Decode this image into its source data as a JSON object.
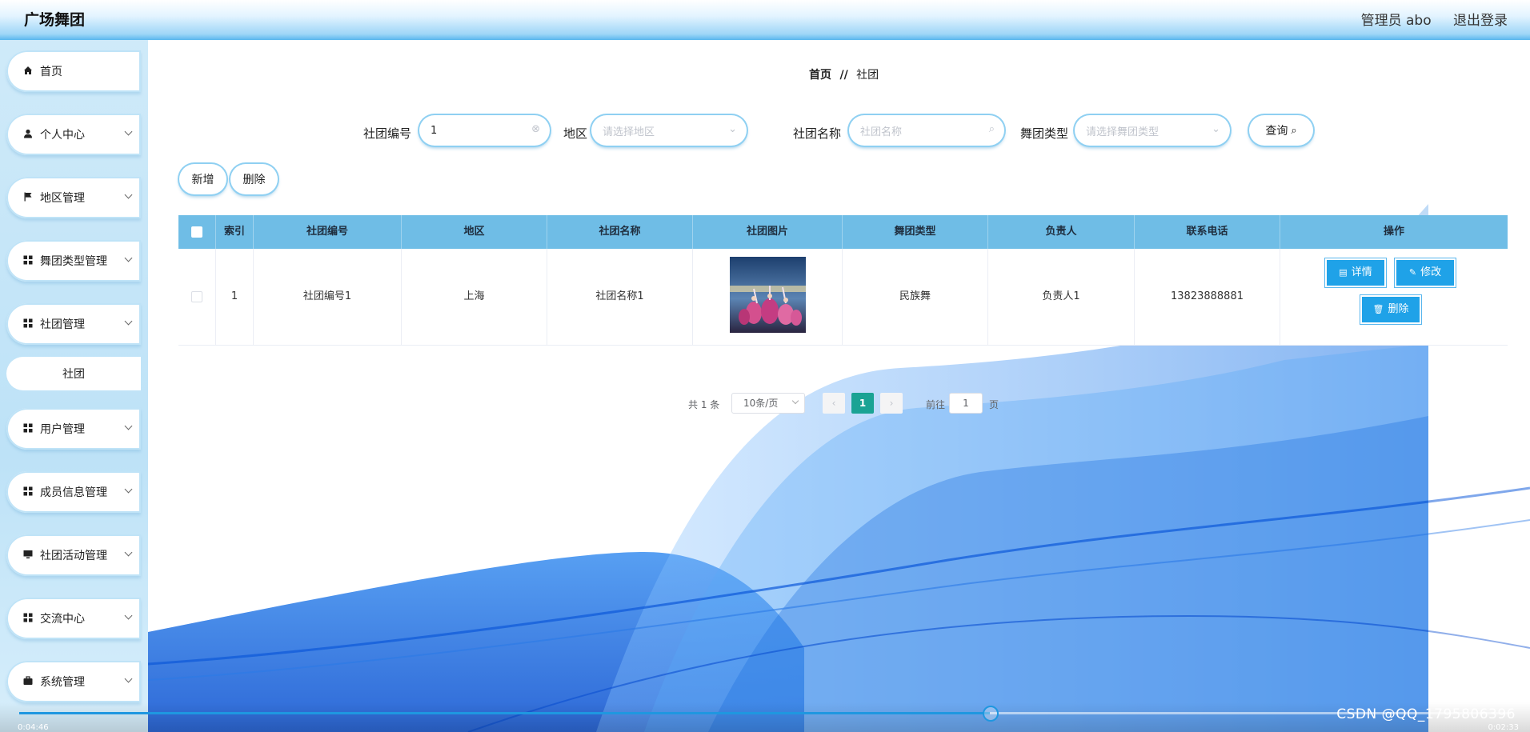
{
  "app": {
    "brand": "广场舞团",
    "admin_label": "管理员 abo",
    "logout": "退出登录"
  },
  "sidebar": {
    "items": [
      {
        "label": "首页",
        "icon": "home-icon"
      },
      {
        "label": "个人中心",
        "icon": "user-icon"
      },
      {
        "label": "地区管理",
        "icon": "flag-icon"
      },
      {
        "label": "舞团类型管理",
        "icon": "grid-icon"
      },
      {
        "label": "社团管理",
        "icon": "grid-icon"
      },
      {
        "label": "用户管理",
        "icon": "grid-icon"
      },
      {
        "label": "成员信息管理",
        "icon": "grid-icon"
      },
      {
        "label": "社团活动管理",
        "icon": "monitor-icon"
      },
      {
        "label": "交流中心",
        "icon": "grid-icon"
      },
      {
        "label": "系统管理",
        "icon": "briefcase-icon"
      }
    ],
    "submenu": {
      "label": "社团"
    }
  },
  "breadcrumb": {
    "home": "首页",
    "sep": "//",
    "current": "社团"
  },
  "search": {
    "club_no_label": "社团编号",
    "club_no_value": "1",
    "region_label": "地区",
    "region_placeholder": "请选择地区",
    "club_name_label": "社团名称",
    "club_name_placeholder": "社团名称",
    "dance_type_label": "舞团类型",
    "dance_type_placeholder": "请选择舞团类型",
    "query_button": "查询"
  },
  "actions": {
    "add": "新增",
    "delete": "删除"
  },
  "table": {
    "headers": [
      "索引",
      "社团编号",
      "地区",
      "社团名称",
      "社团图片",
      "舞团类型",
      "负责人",
      "联系电话",
      "操作"
    ],
    "rows": [
      {
        "index": "1",
        "club_no": "社团编号1",
        "region": "上海",
        "club_name": "社团名称1",
        "dance_type": "民族舞",
        "leader": "负责人1",
        "phone": "13823888881"
      }
    ],
    "op_detail": "详情",
    "op_edit": "修改",
    "op_delete": "删除"
  },
  "pagination": {
    "total": "共 1 条",
    "page_size": "10条/页",
    "current_page": "1",
    "goto_label": "前往",
    "goto_value": "1",
    "page_suffix": "页"
  },
  "video": {
    "elapsed": "0:04:46",
    "remaining": "0:02:33",
    "progress": 0.651
  },
  "watermark": "CSDN @QQ_1795806396",
  "colors": {
    "header_blue": "#6fbde6",
    "accent": "#1fa2e8",
    "pager_active": "#1aa394"
  }
}
